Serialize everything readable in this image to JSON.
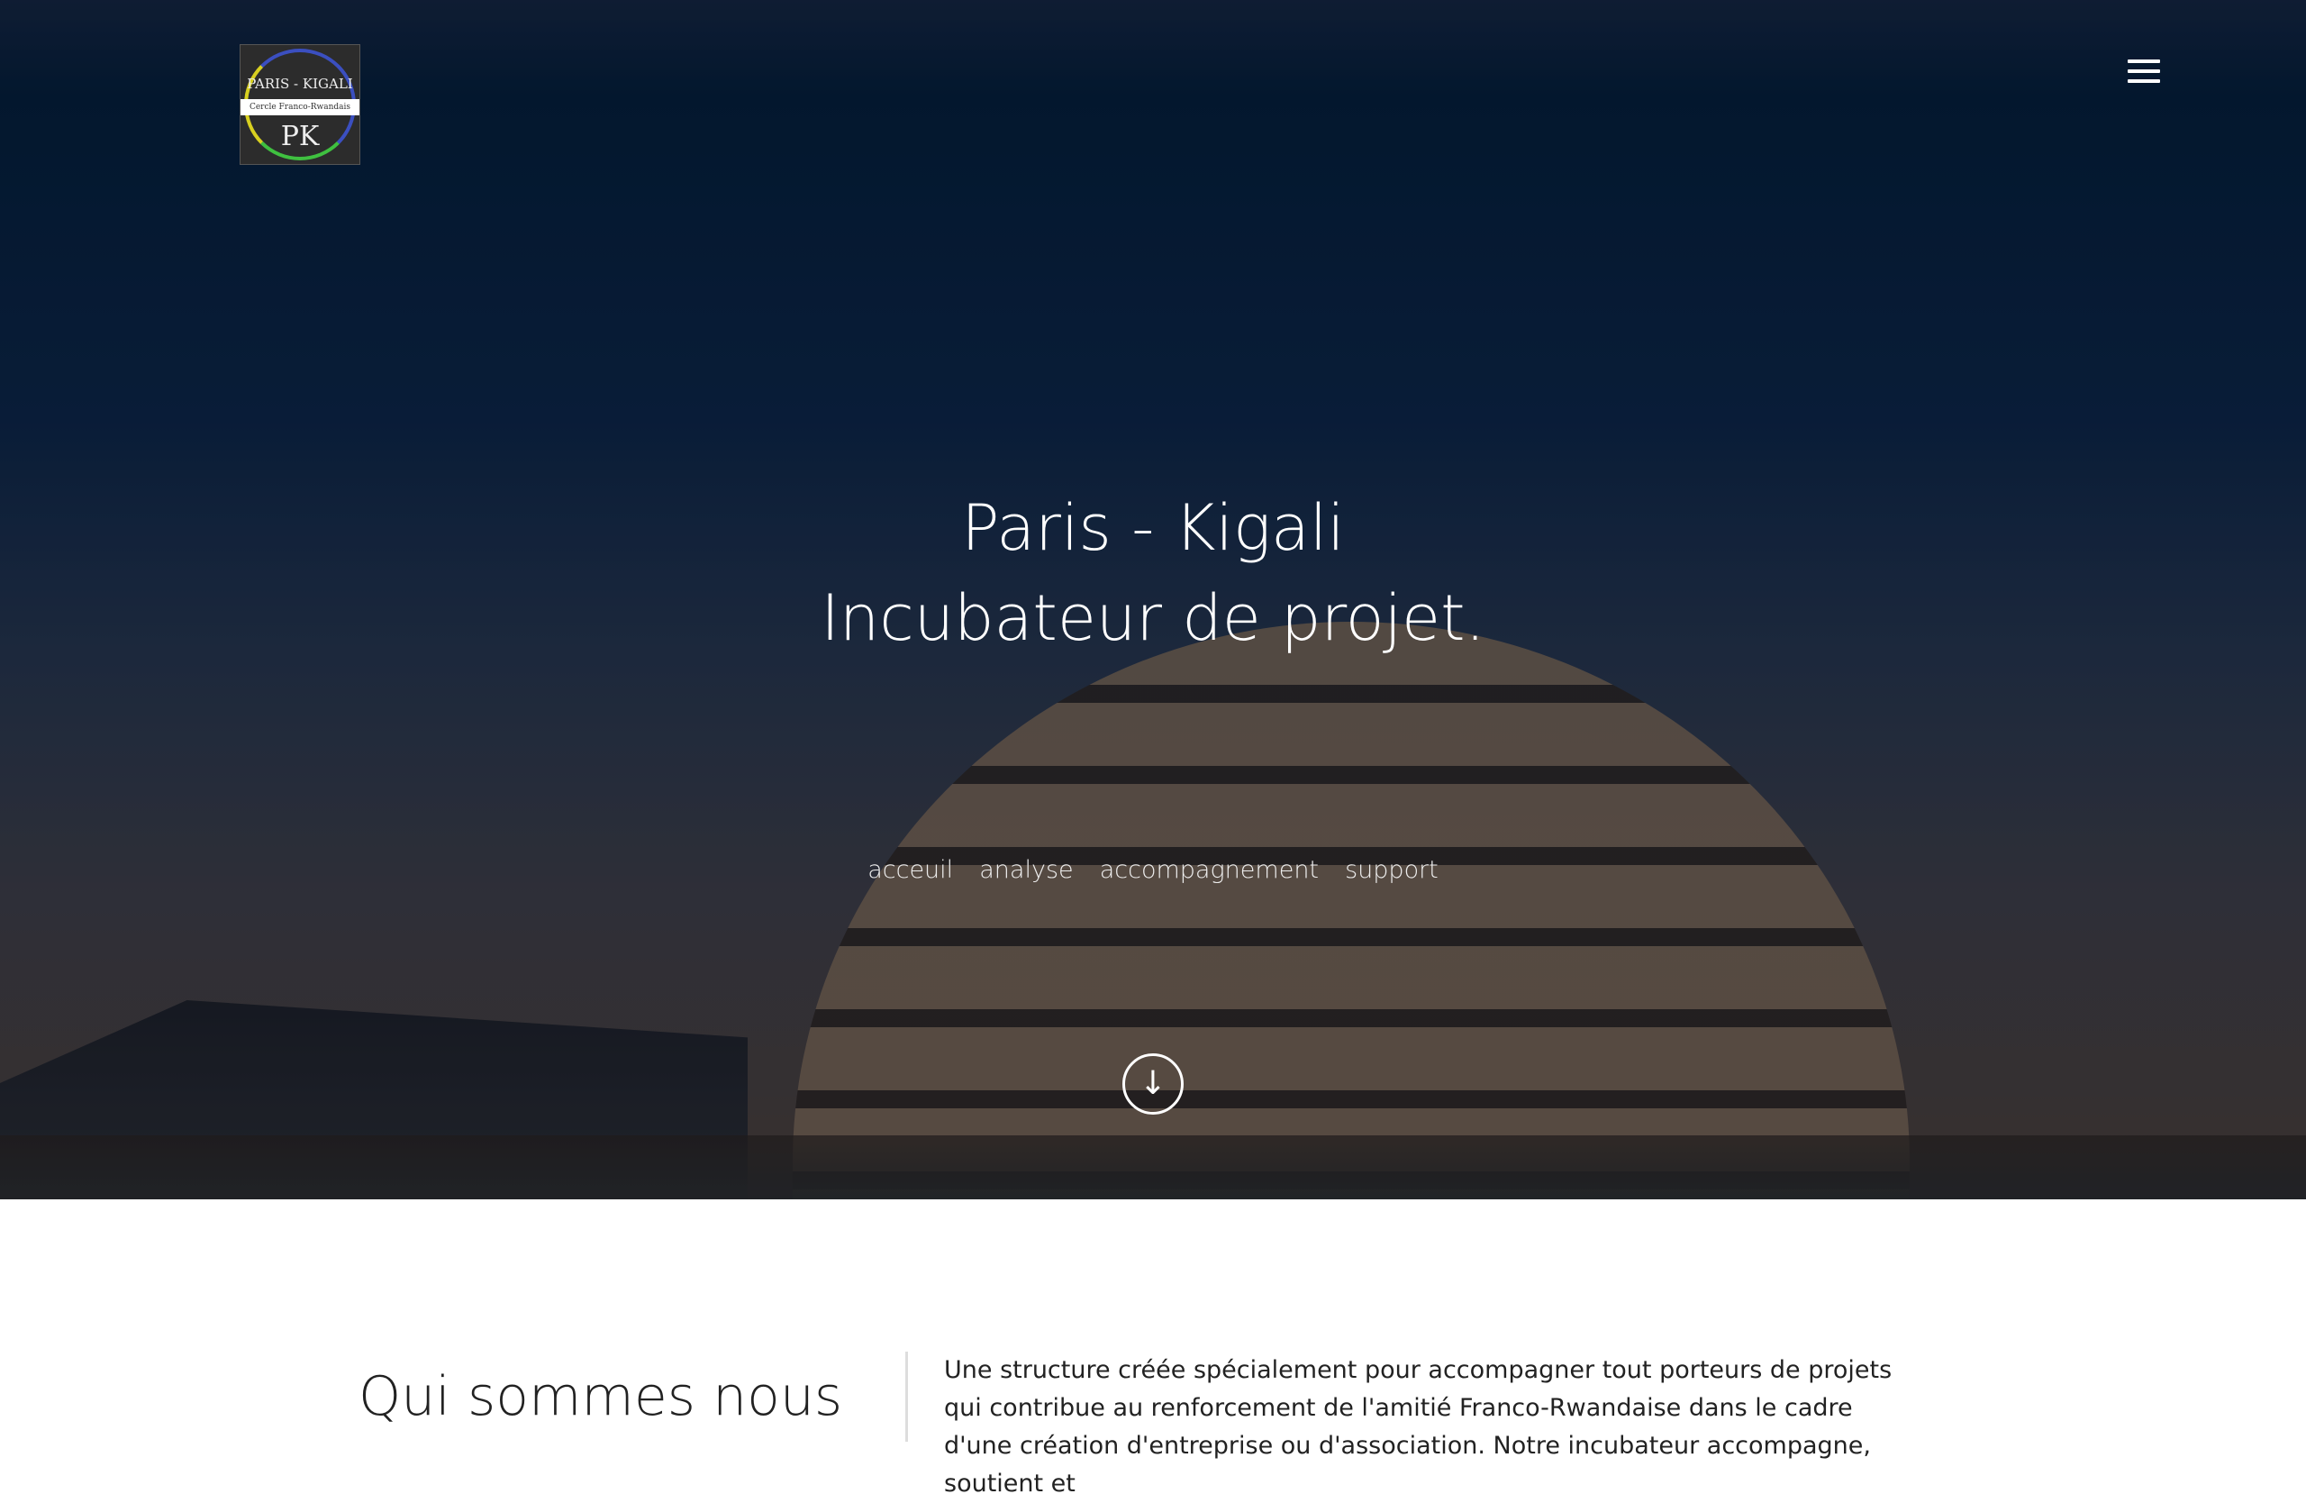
{
  "logo": {
    "top": "PARIS - KIGALI",
    "band": "Cercle Franco-Rwandais",
    "initials": "PK"
  },
  "menu_icon": "hamburger-icon",
  "hero": {
    "line1": "Paris - Kigali",
    "line2": "Incubateur de projet.",
    "scroll_icon": "arrow-down-circle-icon"
  },
  "nav": [
    {
      "label": "acceuil"
    },
    {
      "label": "analyse"
    },
    {
      "label": "accompagnement"
    },
    {
      "label": "support"
    }
  ],
  "about": {
    "title": "Qui sommes nous",
    "text": "Une structure créée spécialement pour accompagner tout porteurs de projets qui contribue au renforcement de l'amitié Franco-Rwandaise dans le cadre d'une création d'entreprise ou d'association. Notre incubateur accompagne, soutient et"
  }
}
